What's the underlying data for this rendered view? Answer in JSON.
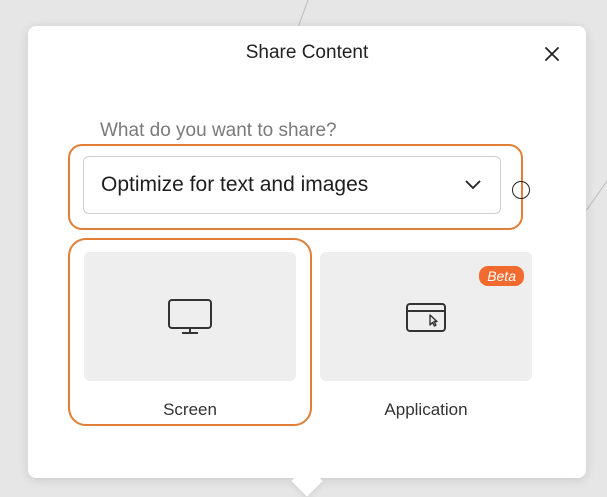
{
  "dialog": {
    "title": "Share Content",
    "question": "What do you want to share?",
    "dropdown": {
      "selected": "Optimize for text and images"
    },
    "options": [
      {
        "label": "Screen",
        "icon": "monitor-icon",
        "highlighted": true
      },
      {
        "label": "Application",
        "icon": "app-window-cursor-icon",
        "badge": "Beta"
      }
    ]
  },
  "colors": {
    "highlight": "#e07f35",
    "badge": "#f26b2e",
    "card_bg": "#eeeeee"
  }
}
